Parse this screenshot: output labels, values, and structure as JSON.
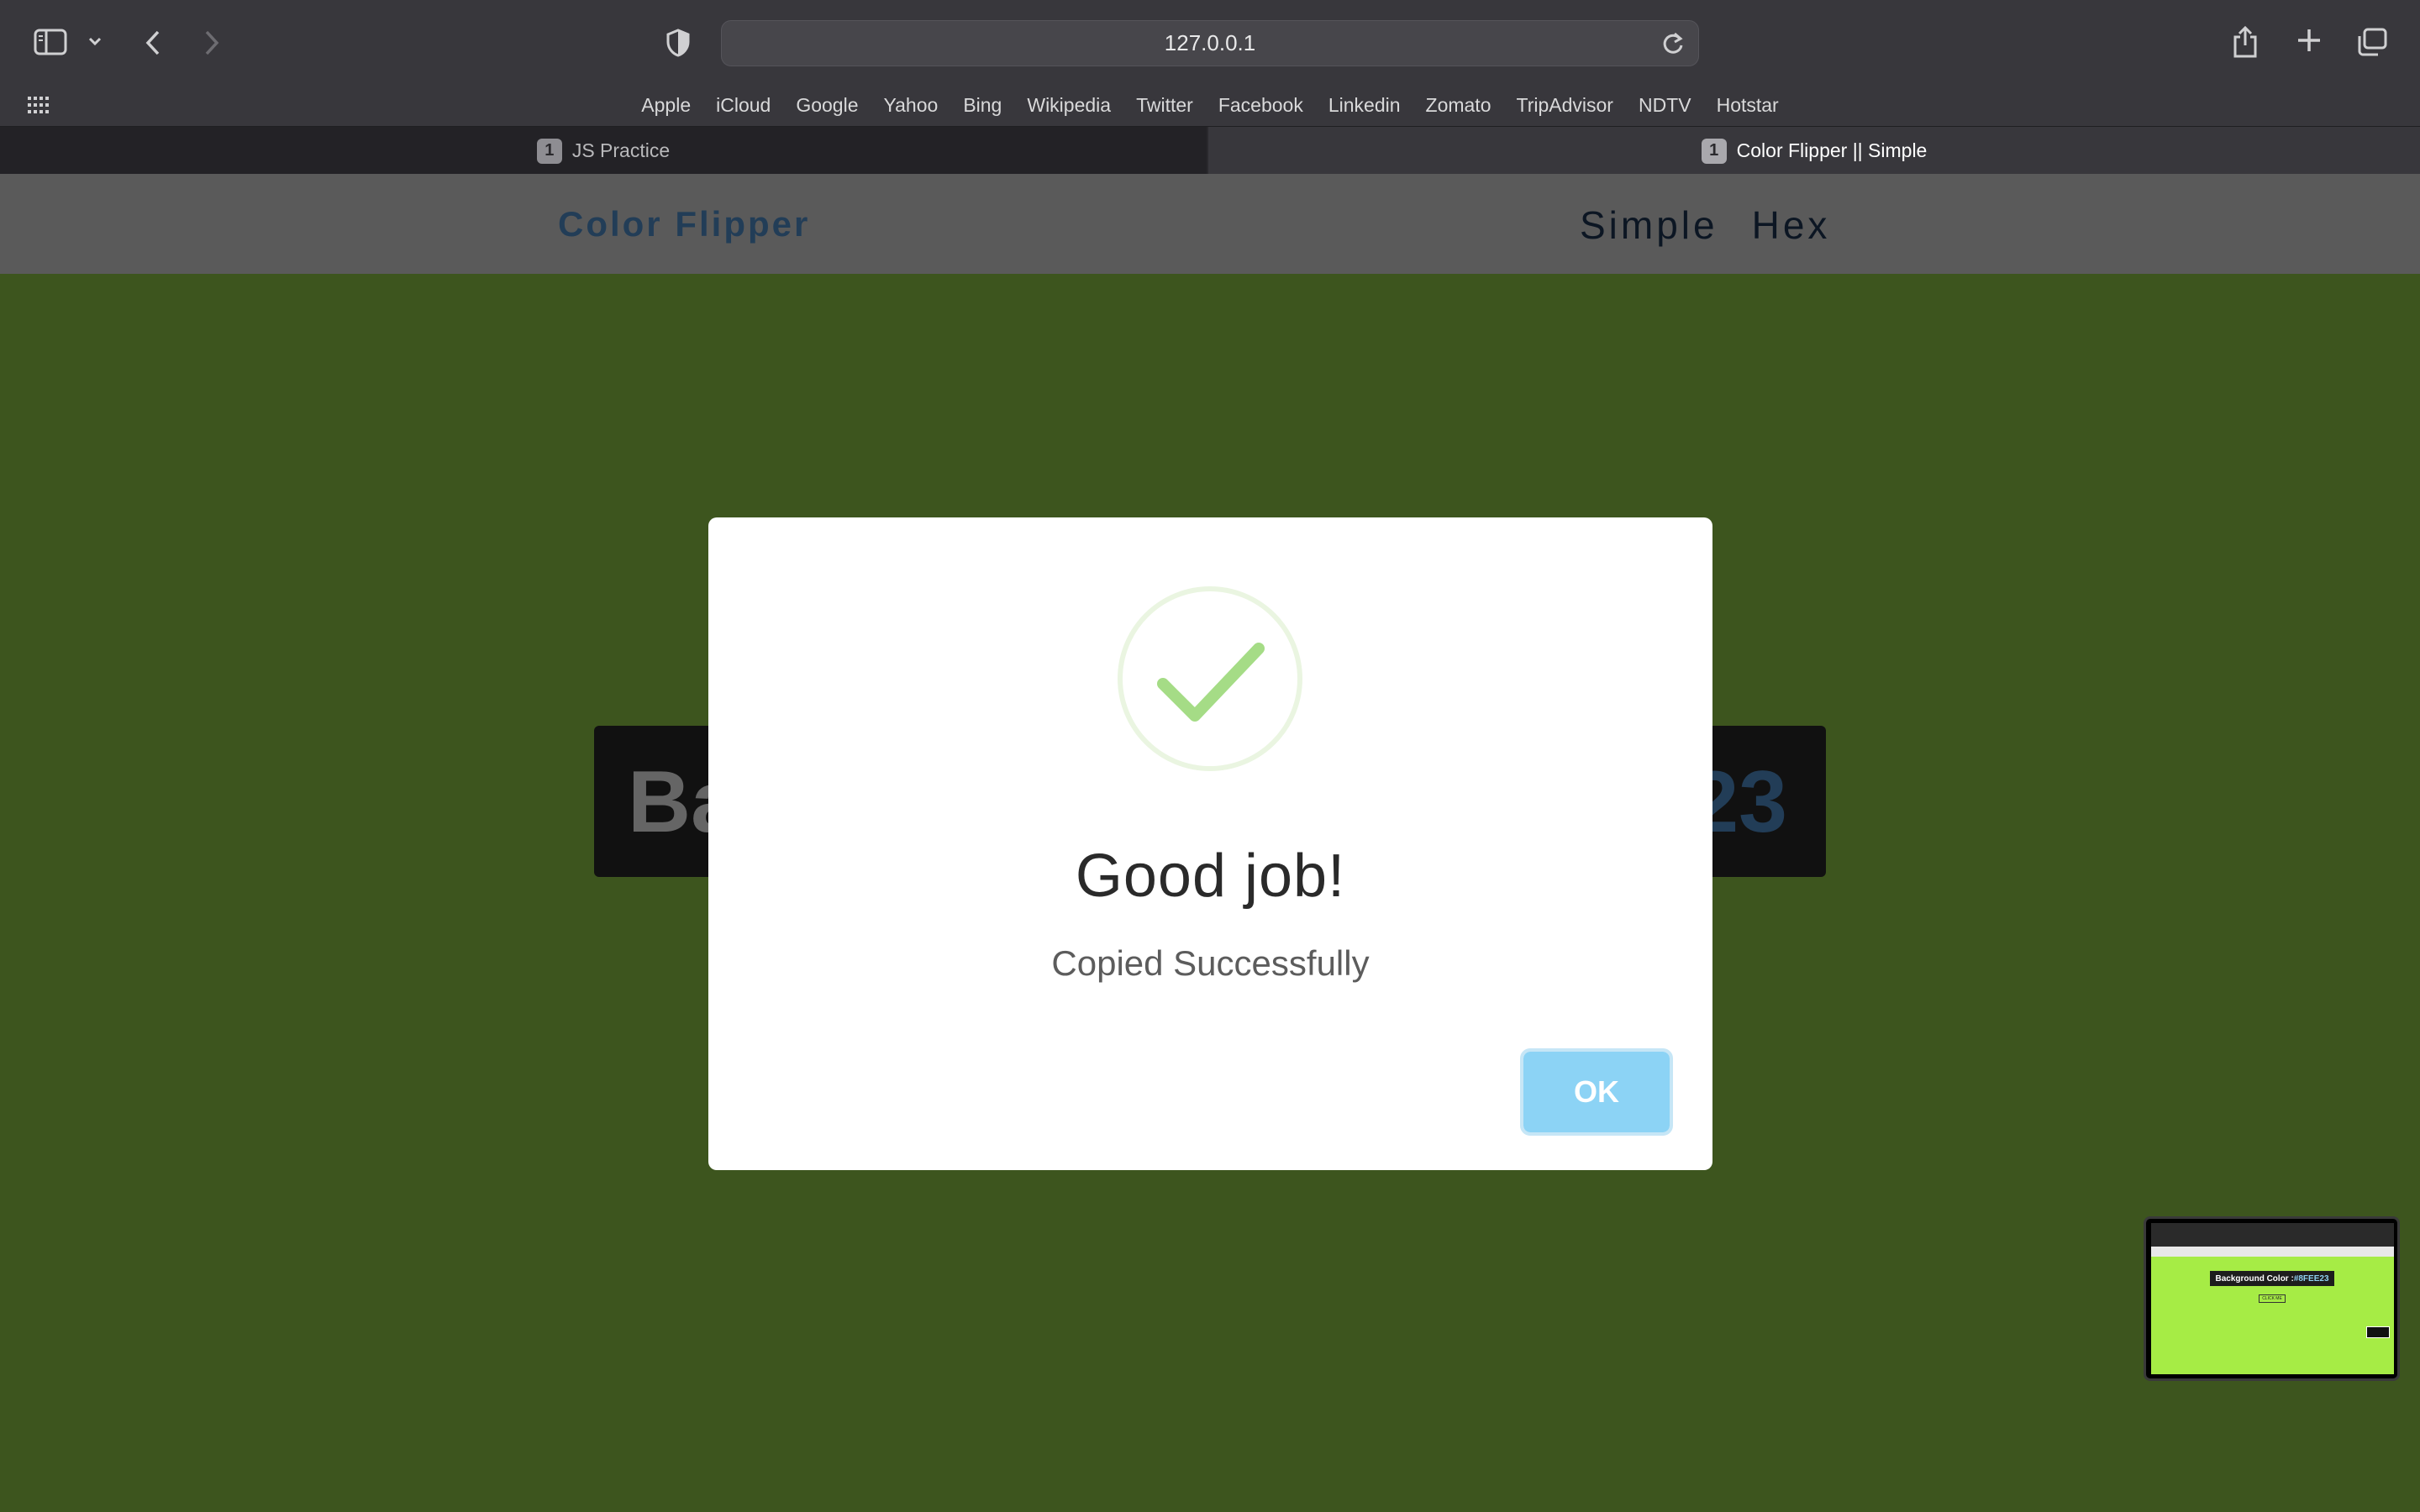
{
  "browser": {
    "url": "127.0.0.1",
    "favorites": [
      "Apple",
      "iCloud",
      "Google",
      "Yahoo",
      "Bing",
      "Wikipedia",
      "Twitter",
      "Facebook",
      "Linkedin",
      "Zomato",
      "TripAdvisor",
      "NDTV",
      "Hotstar"
    ],
    "tabs": [
      {
        "badge": "1",
        "title": "JS Practice",
        "active": false
      },
      {
        "badge": "1",
        "title": "Color Flipper || Simple",
        "active": true
      }
    ]
  },
  "site": {
    "brand": "Color Flipper",
    "nav": [
      "Simple",
      "Hex"
    ],
    "banner_left": "Ba",
    "banner_right": "23",
    "background_color": "#668e32"
  },
  "modal": {
    "title": "Good job!",
    "text": "Copied Successfully",
    "ok_label": "OK"
  },
  "thumbnail": {
    "banner_label": "Background Color : ",
    "banner_hex": "#8FEE23",
    "button_label": "CLICK ME"
  },
  "colors": {
    "accent": "#3a6691",
    "ok_button": "#8cd3f5",
    "success_check": "#a5dc86"
  }
}
